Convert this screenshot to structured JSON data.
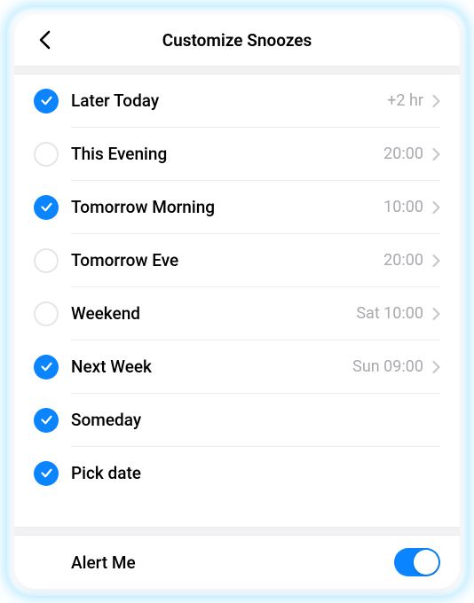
{
  "header": {
    "title": "Customize Snoozes"
  },
  "options": [
    {
      "label": "Later Today",
      "value": "+2 hr",
      "checked": true,
      "hasChevron": true
    },
    {
      "label": "This Evening",
      "value": "20:00",
      "checked": false,
      "hasChevron": true
    },
    {
      "label": "Tomorrow Morning",
      "value": "10:00",
      "checked": true,
      "hasChevron": true
    },
    {
      "label": "Tomorrow Eve",
      "value": "20:00",
      "checked": false,
      "hasChevron": true
    },
    {
      "label": "Weekend",
      "value": "Sat 10:00",
      "checked": false,
      "hasChevron": true
    },
    {
      "label": "Next Week",
      "value": "Sun 09:00",
      "checked": true,
      "hasChevron": true
    },
    {
      "label": "Someday",
      "value": "",
      "checked": true,
      "hasChevron": false
    },
    {
      "label": "Pick date",
      "value": "",
      "checked": true,
      "hasChevron": false
    }
  ],
  "alert": {
    "label": "Alert Me",
    "on": true
  },
  "colors": {
    "accent": "#0a84ff"
  }
}
